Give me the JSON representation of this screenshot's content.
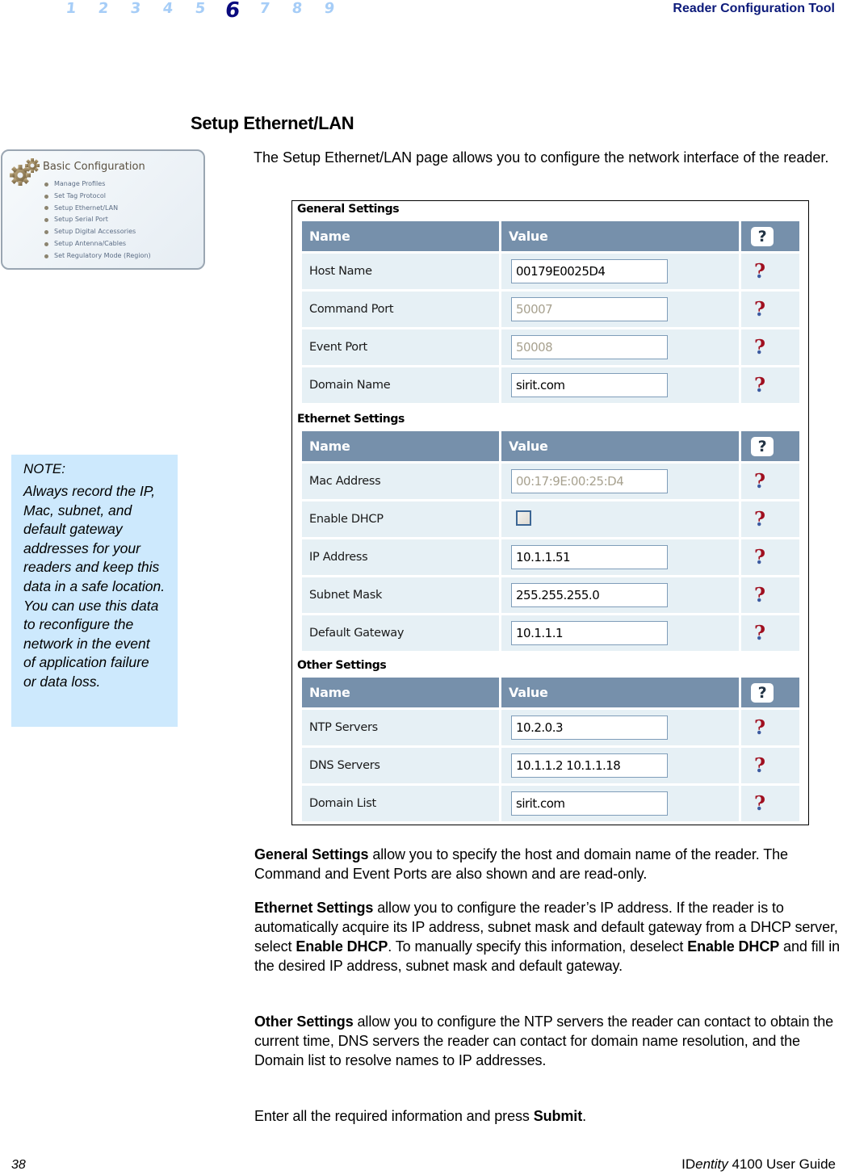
{
  "header": {
    "chapters": [
      "1",
      "2",
      "3",
      "4",
      "5",
      "6",
      "7",
      "8",
      "9"
    ],
    "active_chapter": "6",
    "title": "Reader Configuration Tool"
  },
  "section": {
    "title": "Setup Ethernet/LAN",
    "intro": "The Setup Ethernet/LAN page allows you to configure the network interface of the reader."
  },
  "config_panel": {
    "title": "Basic Configuration",
    "icon": "gears-icon",
    "items": [
      "Manage Profiles",
      "Set Tag Protocol",
      "Setup Ethernet/LAN",
      "Setup Serial Port",
      "Setup Digital Accessories",
      "Setup Antenna/Cables",
      "Set Regulatory Mode (Region)"
    ]
  },
  "screenshot": {
    "columns": {
      "name": "Name",
      "value": "Value",
      "help": "?"
    },
    "groups": [
      {
        "title": "General Settings",
        "rows": [
          {
            "name": "Host Name",
            "type": "text",
            "value": "00179E0025D4",
            "readonly": false
          },
          {
            "name": "Command Port",
            "type": "text",
            "value": "50007",
            "readonly": true
          },
          {
            "name": "Event Port",
            "type": "text",
            "value": "50008",
            "readonly": true
          },
          {
            "name": "Domain Name",
            "type": "text",
            "value": "sirit.com",
            "readonly": false
          }
        ]
      },
      {
        "title": "Ethernet Settings",
        "rows": [
          {
            "name": "Mac Address",
            "type": "text",
            "value": "00:17:9E:00:25:D4",
            "readonly": true
          },
          {
            "name": "Enable DHCP",
            "type": "checkbox",
            "checked": false
          },
          {
            "name": "IP Address",
            "type": "text",
            "value": "10.1.1.51",
            "readonly": false
          },
          {
            "name": "Subnet Mask",
            "type": "text",
            "value": "255.255.255.0",
            "readonly": false
          },
          {
            "name": "Default Gateway",
            "type": "text",
            "value": "10.1.1.1",
            "readonly": false
          }
        ]
      },
      {
        "title": "Other Settings",
        "rows": [
          {
            "name": "NTP Servers",
            "type": "text",
            "value": "10.2.0.3",
            "readonly": false
          },
          {
            "name": "DNS Servers",
            "type": "text",
            "value": "10.1.1.2 10.1.1.18",
            "readonly": false
          },
          {
            "name": "Domain List",
            "type": "text",
            "value": "sirit.com",
            "readonly": false
          }
        ]
      }
    ],
    "row_help_glyph": "?"
  },
  "note": {
    "label": "NOTE:",
    "text": "Always record the IP, Mac, subnet, and default gateway addresses for your readers and keep this data in a safe location. You can use this data to reconfigure the network in the event of application failure or data loss."
  },
  "paragraphs": {
    "general": {
      "bold": "General Settings",
      "text": " allow you to specify the host and domain name of the reader. The Command and Event Ports are also shown and are read-only."
    },
    "ethernet": {
      "bold": "Ethernet Settings",
      "text1": " allow you to configure the reader’s IP address. If the reader is to automatically acquire its IP address, subnet mask and default gateway from a DHCP server, select ",
      "bold2": "Enable DHCP",
      "text2": ". To manually specify this information, deselect ",
      "bold3": "Enable DHCP",
      "text3": " and fill in the desired IP address, subnet mask and default gateway."
    },
    "other": {
      "bold": "Other Settings",
      "text": " allow you to configure the NTP servers the reader can contact to obtain the current time, DNS servers the reader can contact for domain name resolution, and the Domain list to resolve names to IP addresses."
    },
    "submit": {
      "text": "Enter all the required information and press ",
      "bold": "Submit",
      "end": "."
    }
  },
  "footer": {
    "page_number": "38",
    "guide_prefix": "ID",
    "guide_italic": "entity",
    "guide_suffix": " 4100 User Guide"
  },
  "colors": {
    "header_title": "#0c1a7a",
    "chapter_inactive": "#a6cdf7",
    "chapter_active": "#0a0a7e",
    "table_header": "#7690ab",
    "table_cell": "#e6f0f5",
    "note_bg": "#cde9fd"
  }
}
